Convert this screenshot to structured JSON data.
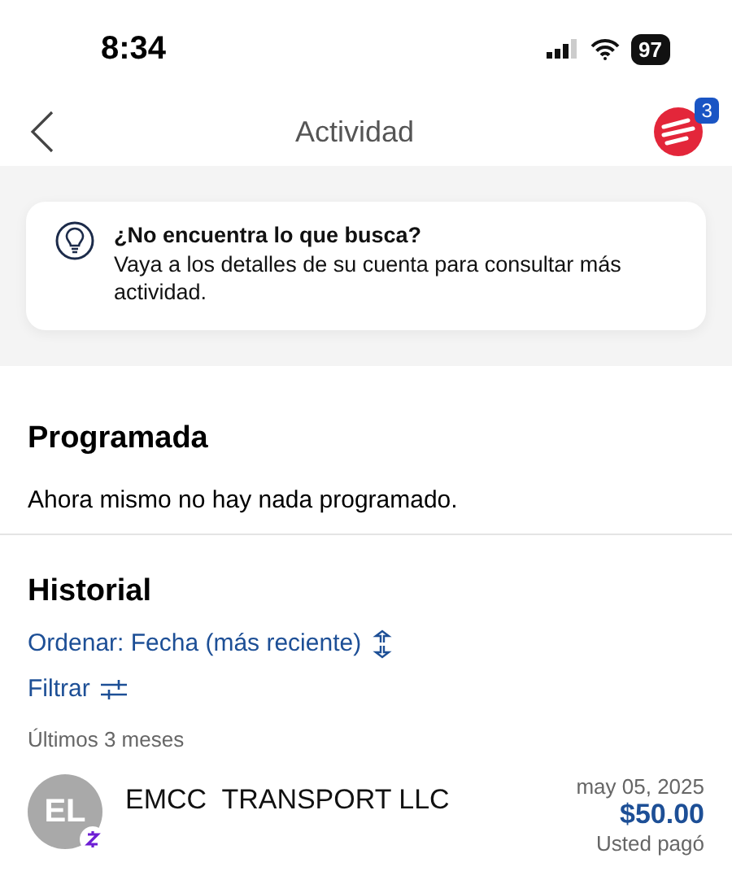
{
  "status_bar": {
    "time": "8:34",
    "battery": "97"
  },
  "header": {
    "title": "Actividad",
    "notification_count": "3"
  },
  "tip": {
    "title": "¿No encuentra lo que busca?",
    "text": "Vaya a los detalles de su cuenta para consultar más actividad."
  },
  "scheduled": {
    "heading": "Programada",
    "empty_text": "Ahora mismo no hay nada programado."
  },
  "history": {
    "heading": "Historial",
    "sort_label": "Ordenar: Fecha (más reciente)",
    "filter_label": "Filtrar",
    "period": "Últimos 3 meses",
    "transactions": [
      {
        "initials": "EL",
        "name": "EMCC  TRANSPORT LLC",
        "date": "may 05, 2025",
        "amount": "$50.00",
        "note": "Usted pagó"
      }
    ]
  }
}
